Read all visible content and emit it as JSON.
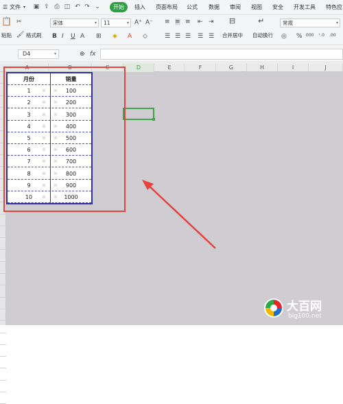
{
  "menubar": {
    "file_label": "文件",
    "tabs": [
      {
        "label": "开始",
        "active": true
      },
      {
        "label": "插入"
      },
      {
        "label": "页面布局"
      },
      {
        "label": "公式"
      },
      {
        "label": "数据"
      },
      {
        "label": "审阅"
      },
      {
        "label": "视图"
      },
      {
        "label": "安全"
      },
      {
        "label": "开发工具"
      },
      {
        "label": "特色应"
      }
    ],
    "accent_color": "#2f9e44"
  },
  "ribbon": {
    "paste_label": "粘贴",
    "format_painter_label": "格式刷",
    "font_name": "宋体",
    "font_size": "11",
    "merge_center_label": "合并居中",
    "wrap_text_label": "自动换行",
    "number_format": "常规",
    "percent_symbol": "%"
  },
  "formula_bar": {
    "cell_ref": "D4",
    "fx_label": "fx",
    "value": ""
  },
  "columns": [
    "A",
    "B",
    "C",
    "D",
    "E",
    "F",
    "G",
    "H",
    "I",
    "J"
  ],
  "table": {
    "headers": [
      "月份",
      "销量"
    ],
    "rows": [
      {
        "month": "1",
        "sales": "100"
      },
      {
        "month": "2",
        "sales": "200"
      },
      {
        "month": "3",
        "sales": "300"
      },
      {
        "month": "4",
        "sales": "400"
      },
      {
        "month": "5",
        "sales": "500"
      },
      {
        "month": "6",
        "sales": "600"
      },
      {
        "month": "7",
        "sales": "700"
      },
      {
        "month": "8",
        "sales": "800"
      },
      {
        "month": "9",
        "sales": "900"
      },
      {
        "month": "10",
        "sales": "1000"
      }
    ]
  },
  "watermark": {
    "brand": "大百网",
    "url": "big100.net"
  },
  "annotation_color": "#e8403a"
}
